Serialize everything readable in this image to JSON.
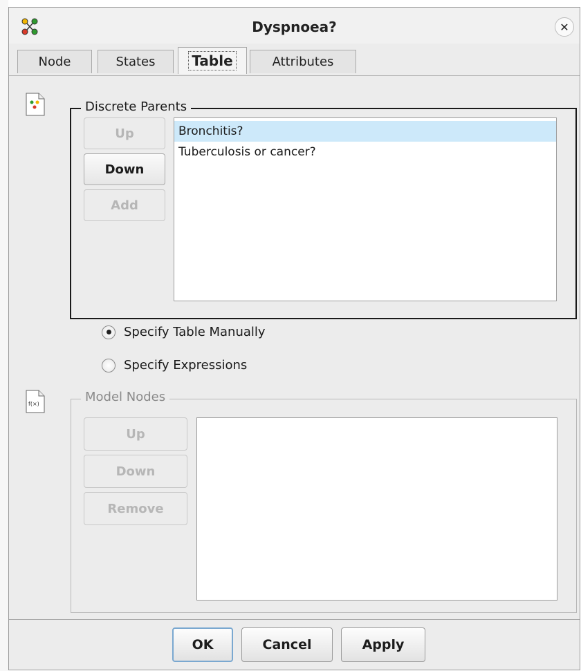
{
  "window": {
    "title": "Dyspnoea?",
    "close_icon": "close-icon",
    "app_icon": "network-nodes-icon"
  },
  "tabs": [
    {
      "label": "Node",
      "active": false
    },
    {
      "label": "States",
      "active": false
    },
    {
      "label": "Table",
      "active": true
    },
    {
      "label": "Attributes",
      "active": false
    }
  ],
  "discrete_parents": {
    "title": "Discrete Parents",
    "icon": "table-doc-icon",
    "buttons": {
      "up": "Up",
      "down": "Down",
      "add": "Add"
    },
    "items": [
      {
        "label": "Bronchitis?",
        "selected": true
      },
      {
        "label": "Tuberculosis or cancer?",
        "selected": false
      }
    ]
  },
  "specify": {
    "options": [
      {
        "label": "Specify Table Manually",
        "checked": true
      },
      {
        "label": "Specify Expressions",
        "checked": false
      }
    ]
  },
  "model_nodes": {
    "title": "Model Nodes",
    "icon": "function-doc-icon",
    "buttons": {
      "up": "Up",
      "down": "Down",
      "remove": "Remove"
    }
  },
  "footer": {
    "ok": "OK",
    "cancel": "Cancel",
    "apply": "Apply"
  },
  "colors": {
    "selection": "#cde9fa",
    "focus_border": "#7aa8d0"
  }
}
